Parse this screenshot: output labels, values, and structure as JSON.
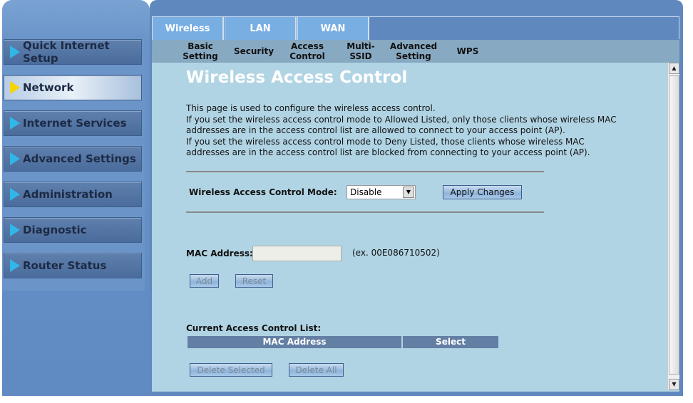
{
  "sidebar": {
    "items": [
      {
        "label": "Quick Internet Setup",
        "active": false
      },
      {
        "label": "Network",
        "active": true
      },
      {
        "label": "Internet Services",
        "active": false
      },
      {
        "label": "Advanced Settings",
        "active": false
      },
      {
        "label": "Administration",
        "active": false
      },
      {
        "label": "Diagnostic",
        "active": false
      },
      {
        "label": "Router Status",
        "active": false
      }
    ]
  },
  "tabs": [
    {
      "label": "Wireless"
    },
    {
      "label": "LAN"
    },
    {
      "label": "WAN"
    }
  ],
  "subtabs": [
    {
      "label": "Basic Setting"
    },
    {
      "label": "Security"
    },
    {
      "label": "Access Control"
    },
    {
      "label": "Multi-SSID"
    },
    {
      "label": "Advanced Setting"
    },
    {
      "label": "WPS"
    }
  ],
  "page": {
    "title": "Wireless Access Control",
    "description": [
      "This page is used to configure the wireless access control.",
      "If you set the wireless access control mode to Allowed Listed, only those clients whose wireless MAC addresses are in the access control list are allowed to connect to your access point (AP).",
      "If you set the wireless access control mode to Deny Listed, those clients whose wireless MAC addresses are in the access control list are blocked from connecting to your access point (AP)."
    ],
    "mode_label": "Wireless Access Control Mode:",
    "mode_value": "Disable",
    "apply_label": "Apply Changes",
    "mac_label": "MAC Address:",
    "mac_value": "",
    "mac_example": "(ex. 00E086710502)",
    "add_label": "Add",
    "reset_label": "Reset",
    "list_label": "Current Access Control List:",
    "columns": [
      "MAC Address",
      "Select"
    ],
    "delete_selected_label": "Delete Selected",
    "delete_all_label": "Delete All"
  },
  "colors": {
    "accent": "#5f88bf",
    "content_bg": "#b1d4e4",
    "tab": "#79aee3",
    "active_arrow": "#f5d400",
    "arrow": "#31b6e8"
  }
}
